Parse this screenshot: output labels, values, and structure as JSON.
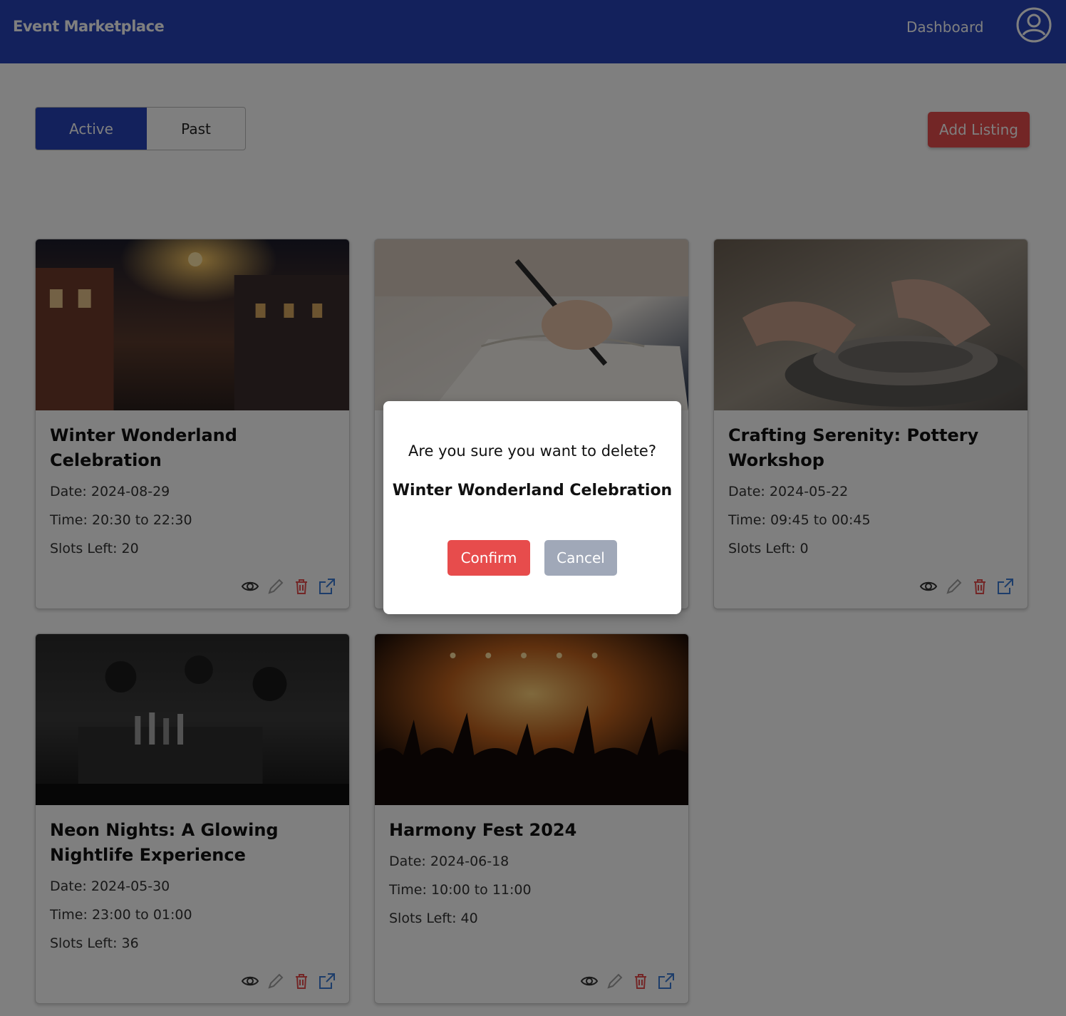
{
  "header": {
    "brand": "Event Marketplace",
    "nav_dashboard": "Dashboard",
    "avatar_icon": "user-circle-icon"
  },
  "tabs": [
    {
      "label": "Active",
      "selected": true
    },
    {
      "label": "Past",
      "selected": false
    }
  ],
  "add_listing_label": "Add Listing",
  "colors": {
    "primary": "#2643b8",
    "danger": "#e74c4c",
    "muted_button": "#a0a8b8",
    "edit_icon": "#a0a0a0",
    "delete_icon": "#e74c4c",
    "share_icon": "#3a7bd5"
  },
  "listings": [
    {
      "title": "Winter Wonderland Celebration",
      "date": "Date: 2024-08-29",
      "time": "Time: 20:30 to 22:30",
      "slots": "Slots Left: 20",
      "image": "snowy-street-night-photo"
    },
    {
      "title": "",
      "date": "",
      "time": "",
      "slots": "",
      "image": "writing-in-notebook-photo"
    },
    {
      "title": "Crafting Serenity: Pottery Workshop",
      "date": "Date: 2024-05-22",
      "time": "Time: 09:45 to 00:45",
      "slots": "Slots Left: 0",
      "image": "pottery-wheel-photo"
    },
    {
      "title": "Neon Nights: A Glowing Nightlife Experience",
      "date": "Date: 2024-05-30",
      "time": "Time: 23:00 to 01:00",
      "slots": "Slots Left: 36",
      "image": "nightclub-bar-photo"
    },
    {
      "title": "Harmony Fest 2024",
      "date": "Date: 2024-06-18",
      "time": "Time: 10:00 to 11:00",
      "slots": "Slots Left: 40",
      "image": "concert-crowd-photo"
    }
  ],
  "card_action_icons": [
    "eye-icon",
    "pencil-icon",
    "trash-icon",
    "external-link-icon"
  ],
  "modal": {
    "question": "Are you sure you want to delete?",
    "item_name": "Winter Wonderland Celebration",
    "confirm_label": "Confirm",
    "cancel_label": "Cancel"
  }
}
